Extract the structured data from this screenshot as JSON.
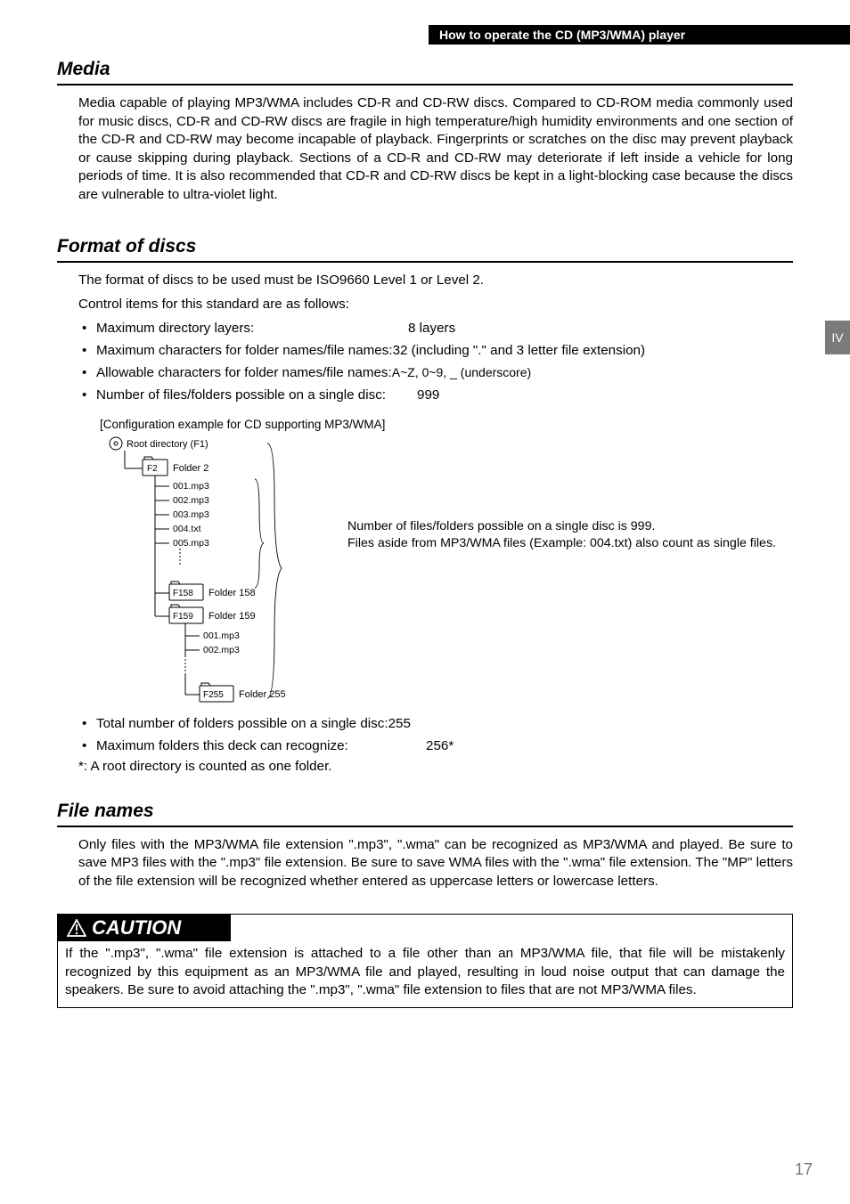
{
  "header": {
    "title": "How to operate the CD (MP3/WMA) player"
  },
  "sidebar": {
    "chapter": "IV"
  },
  "sections": {
    "media": {
      "title": "Media",
      "body": "Media capable of playing MP3/WMA includes CD-R and CD-RW discs. Compared to CD-ROM media commonly used for music discs, CD-R and CD-RW discs are fragile in high temperature/high humidity environments and one section of the CD-R and CD-RW may become incapable of playback. Fingerprints or scratches on the disc may prevent playback or cause skipping during playback. Sections of a CD-R and CD-RW may deteriorate if left inside a vehicle for long periods of time. It is also recommended that CD-R and CD-RW discs be kept in a light-blocking case because the discs are vulnerable to ultra-violet light."
    },
    "format": {
      "title": "Format of discs",
      "intro1": "The format of discs to be used must be ISO9660 Level 1 or Level 2.",
      "intro2": "Control items for this standard are as follows:",
      "items": [
        {
          "label": "Maximum directory layers:",
          "value": "8 layers"
        },
        {
          "label": "Maximum characters for folder names/file names:",
          "value": "32 (including \".\" and 3 letter file extension)"
        },
        {
          "label": "Allowable characters for folder names/file names:",
          "value": "A~Z, 0~9, _ (underscore)"
        },
        {
          "label": "Number of files/folders possible on a single disc:",
          "value": "999"
        }
      ],
      "config_caption": "[Configuration example for CD supporting MP3/WMA]",
      "tree": {
        "root": "Root directory (F1)",
        "f2_tag": "F2",
        "f2_label": "Folder 2",
        "files_a": [
          "001.mp3",
          "002.mp3",
          "003.mp3",
          "004.txt",
          "005.mp3"
        ],
        "f158_tag": "F158",
        "f158_label": "Folder 158",
        "f159_tag": "F159",
        "f159_label": "Folder 159",
        "files_b": [
          "001.mp3",
          "002.mp3"
        ],
        "f255_tag": "F255",
        "f255_label": "Folder 255"
      },
      "diagram_note1": "Number of files/folders possible on a single disc is 999.",
      "diagram_note2": "Files aside from MP3/WMA files (Example: 004.txt) also count as single files.",
      "items2": [
        {
          "label": "Total number of folders possible on a single disc:",
          "value": "255"
        },
        {
          "label": "Maximum folders this deck can recognize:",
          "value": "256*"
        }
      ],
      "footnote": "*: A root directory is counted as one folder."
    },
    "filenames": {
      "title": "File names",
      "body": "Only files with the MP3/WMA file extension \".mp3\", \".wma\" can be recognized as MP3/WMA and played. Be sure to save MP3 files with the \".mp3\" file extension. Be sure to save WMA files with the \".wma\" file extension. The \"MP\" letters of the file extension will be recognized whether entered as uppercase letters or lowercase letters."
    },
    "caution": {
      "title": "CAUTION",
      "body": "If the \".mp3\", \".wma\" file extension is attached to a file other than an MP3/WMA file, that file will be mistakenly recognized by this equipment as an MP3/WMA file and played, resulting in loud noise output that can damage the speakers. Be sure to avoid attaching the \".mp3\", \".wma\" file extension to files that are not MP3/WMA files."
    }
  },
  "page_number": "17"
}
